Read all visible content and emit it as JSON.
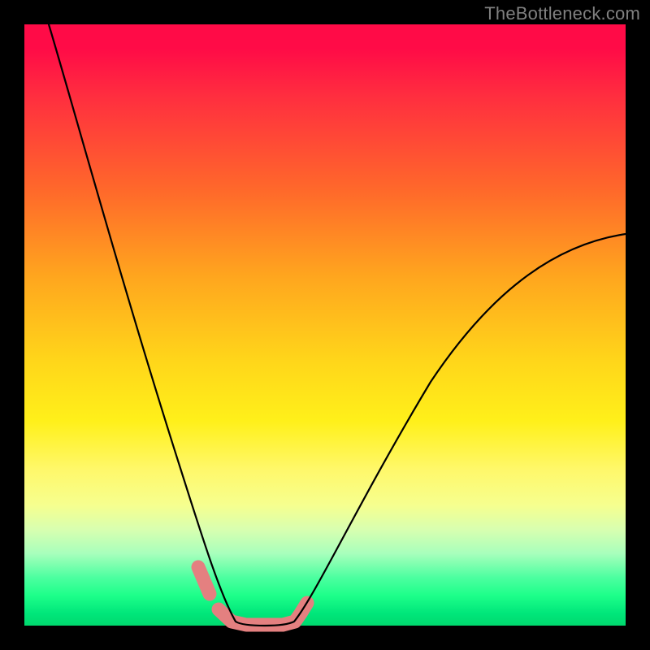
{
  "watermark": "TheBottleneck.com",
  "chart_data": {
    "type": "line",
    "title": "",
    "xlabel": "",
    "ylabel": "",
    "xlim": [
      0,
      100
    ],
    "ylim": [
      0,
      100
    ],
    "grid": false,
    "legend": false,
    "background_gradient_stops": [
      {
        "pct": 0,
        "color": "#ff0b47"
      },
      {
        "pct": 28,
        "color": "#ff6a2a"
      },
      {
        "pct": 56,
        "color": "#ffd61a"
      },
      {
        "pct": 80,
        "color": "#f6ff8f"
      },
      {
        "pct": 95,
        "color": "#1dff8a"
      },
      {
        "pct": 100,
        "color": "#00d96e"
      }
    ],
    "series": [
      {
        "name": "left_branch",
        "x": [
          4,
          8,
          12,
          16,
          20,
          24,
          27,
          29,
          31,
          33,
          35
        ],
        "y": [
          100,
          86,
          72,
          58,
          44,
          30,
          17,
          10,
          5,
          2,
          0
        ]
      },
      {
        "name": "trough",
        "x": [
          35,
          37,
          40,
          43,
          45
        ],
        "y": [
          0,
          0,
          0,
          0,
          0
        ]
      },
      {
        "name": "right_branch",
        "x": [
          45,
          48,
          53,
          60,
          68,
          78,
          90,
          100
        ],
        "y": [
          0,
          3,
          9,
          19,
          32,
          46,
          58,
          65
        ]
      }
    ],
    "annotations": [
      {
        "name": "salmon_markers",
        "description": "pink/salmon raised rounded markers near x≈30 and x≈45 along bottom of curve",
        "points_x": [
          29,
          31,
          32.5,
          34.5,
          37,
          40,
          43,
          45,
          46,
          47
        ],
        "points_y": [
          10,
          5,
          2.5,
          0.5,
          0,
          0,
          0,
          0.5,
          2,
          4
        ],
        "color": "#e48080"
      }
    ]
  }
}
